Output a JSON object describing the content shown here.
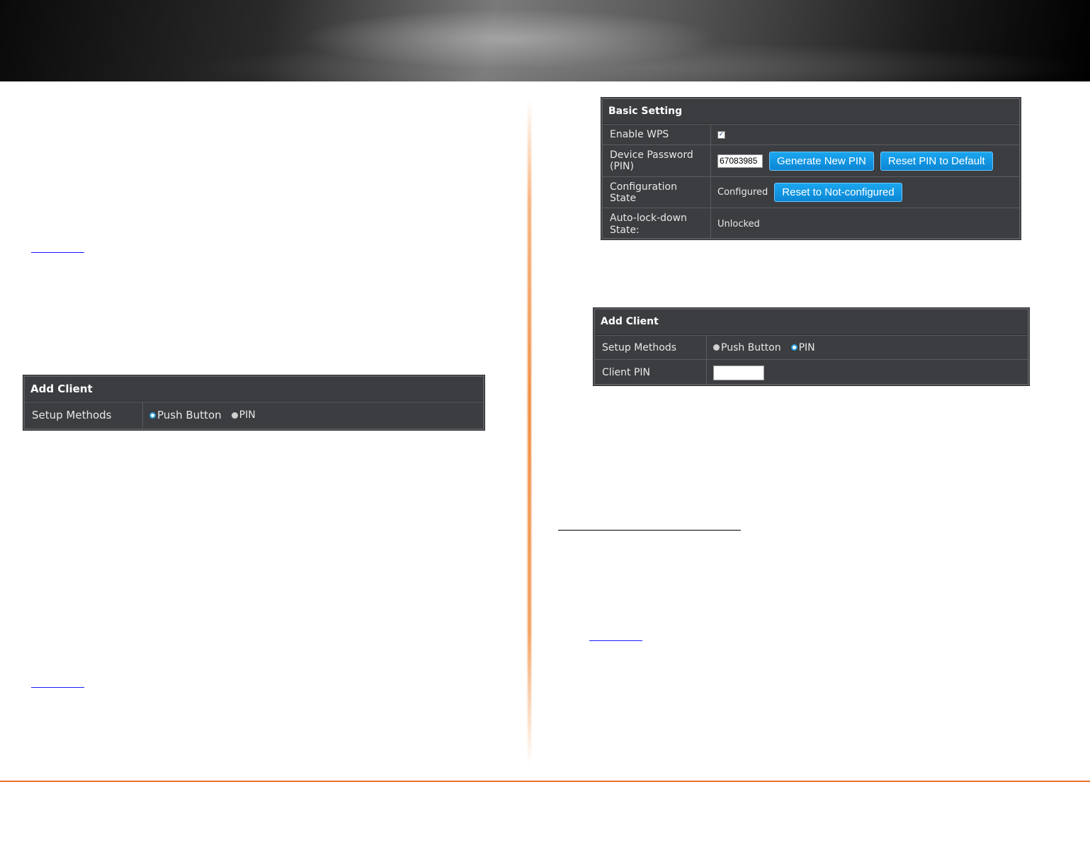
{
  "left_panel": {
    "title": "Add Client",
    "setup_methods_label": "Setup Methods",
    "options": [
      "Push Button",
      "PIN"
    ],
    "selected": "Push Button"
  },
  "basic_setting": {
    "title": "Basic Setting",
    "enable_wps_label": "Enable WPS",
    "enable_wps_checked": true,
    "device_password_label": "Device Password (PIN)",
    "device_password_value": "67083985",
    "generate_pin_button": "Generate New PIN",
    "reset_pin_button": "Reset PIN to Default",
    "config_state_label": "Configuration State",
    "config_state_value": "Configured",
    "reset_not_configured_button": "Reset to Not-configured",
    "autolock_label": "Auto-lock-down State:",
    "autolock_value": "Unlocked"
  },
  "right_panel": {
    "title": "Add Client",
    "setup_methods_label": "Setup Methods",
    "options": [
      "Push Button",
      "PIN"
    ],
    "selected": "PIN",
    "client_pin_label": "Client PIN",
    "client_pin_value": ""
  },
  "colors": {
    "panel_bg": "#3b3d40",
    "button_blue": "#1ba6f0",
    "accent_orange": "#e8742a",
    "link_blue": "#1a1aff"
  }
}
